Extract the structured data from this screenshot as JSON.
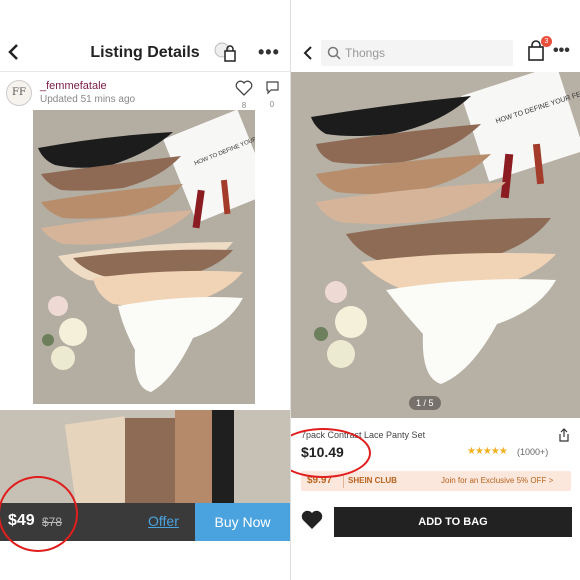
{
  "left": {
    "header_title": "Listing Details",
    "seller_initials": "FF",
    "seller_name": "_femmefatale",
    "updated_text": "Updated 51 mins ago",
    "like_count": "8",
    "comment_count": "0",
    "price_current": "$49",
    "price_original": "$78",
    "offer_label": "Offer",
    "buy_label": "Buy Now",
    "card_text": "HOW TO DEFINE YOUR FEED"
  },
  "right": {
    "search_placeholder": "Thongs",
    "cart_count": "3",
    "pager": "1 / 5",
    "card_text": "HOW TO DEFINE YOUR FEED",
    "product_title": "7pack Contrast Lace Panty Set",
    "price": "$10.49",
    "stars": "★★★★★",
    "reviews": "(1000+)",
    "club_price": "$9.97",
    "club_label": "SHEIN CLUB",
    "club_join": "Join for an Exclusive 5% OFF",
    "add_to_bag": "ADD TO BAG"
  },
  "colors": {
    "poshmark_blue": "#4aa3df",
    "dark_bar": "#3a3a3a",
    "annotation_red": "#e01e1e",
    "shein_club_bg": "#fbe7dc",
    "shein_club_text": "#b8641f"
  },
  "icons": [
    "back-arrow-icon",
    "shop-bag-icon",
    "more-icon",
    "heart-icon",
    "comment-icon",
    "search-icon",
    "bag-icon",
    "share-icon"
  ]
}
